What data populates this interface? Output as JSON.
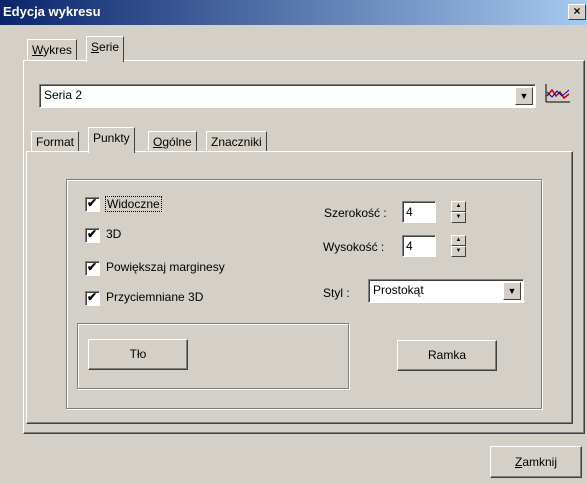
{
  "window": {
    "title": "Edycja wykresu",
    "close_glyph": "×"
  },
  "top_tabs": [
    {
      "label": "Wykres",
      "accel": "W",
      "rest": "ykres"
    },
    {
      "label": "Serie",
      "accel": "S",
      "rest": "erie"
    }
  ],
  "series_select": {
    "value": "Seria 2",
    "icon": "series-chart-icon"
  },
  "sub_tabs": [
    {
      "label": "Format"
    },
    {
      "label": "Punkty"
    },
    {
      "label": "Ogólne",
      "accel": "O",
      "rest": "gólne"
    },
    {
      "label": "Znaczniki"
    }
  ],
  "checkboxes": [
    {
      "label": "Widoczne",
      "checked": true
    },
    {
      "label": "3D",
      "checked": true
    },
    {
      "label": "Powiększaj marginesy",
      "checked": true
    },
    {
      "label": "Przyciemniane 3D",
      "checked": true
    }
  ],
  "check_glyph": "✔",
  "width": {
    "label": "Szerokość :",
    "value": "4"
  },
  "height": {
    "label": "Wysokość :",
    "value": "4"
  },
  "style": {
    "label": "Styl :",
    "value": "Prostokąt"
  },
  "buttons": {
    "background": "Tło",
    "frame": "Ramka",
    "close": {
      "label": "Zamknij",
      "accel": "Z",
      "rest": "amknij"
    }
  },
  "arrows": {
    "down": "▼",
    "up": "▲"
  }
}
